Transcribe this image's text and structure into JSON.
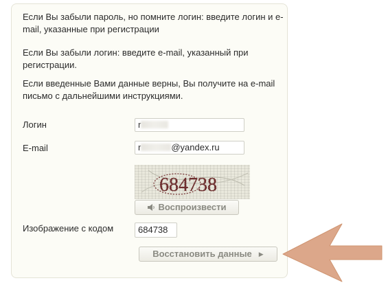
{
  "instructions": [
    "Если Вы забыли пароль, но помните логин: введите логин и e-mail, указанные при регистрации",
    "Если Вы забыли логин: введите e-mail, указанный при регистрации.",
    "Если введенные Вами данные верны, Вы получите на e-mail письмо с дальнейшими инструкциями."
  ],
  "form": {
    "login": {
      "label": "Логин",
      "value_prefix": "r"
    },
    "email": {
      "label": "E-mail",
      "value_prefix": "r",
      "value_suffix": "@yandex.ru"
    },
    "captcha": {
      "text": "684738",
      "play_label": "Воспроизвести",
      "play_icon": "speaker-icon",
      "label": "Изображение с кодом",
      "value": "684738"
    },
    "submit_label": "Восстановить данные",
    "submit_icon": "chevron-right-icon"
  },
  "annotation": {
    "arrow_color": "#d9a080",
    "arrow_icon": "pointer-arrow-icon"
  }
}
